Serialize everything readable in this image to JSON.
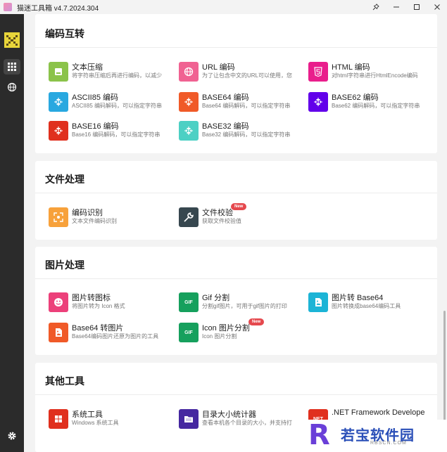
{
  "window": {
    "title": "猫迷工具箱 v4.7.2024.304",
    "icons": [
      "pin-icon",
      "minimize-icon",
      "maximize-icon",
      "close-icon"
    ]
  },
  "sidebar": {
    "items": [
      {
        "icon": "apps-grid-icon",
        "active": true
      },
      {
        "icon": "globe-icon",
        "active": false
      }
    ],
    "bottom_icon": "settings-gear-icon"
  },
  "sections": {
    "encoding": {
      "title": "编码互转",
      "tools": [
        {
          "name": "文本压缩",
          "desc": "将字符串压缩后再进行编码，以减少",
          "icon": "compress-icon",
          "color": "#8bc34a"
        },
        {
          "name": "URL 编码",
          "desc": "为了让包含中文的URL可以使用，您",
          "icon": "globe-icon",
          "color": "#f06292"
        },
        {
          "name": "HTML 编码",
          "desc": "对html字符串进行HtmlEncode编码",
          "icon": "html5-icon",
          "color": "#e91e8c"
        },
        {
          "name": "ASCII85 编码",
          "desc": "ASCII85 编码解码，可以指定字符串",
          "icon": "code-transform-icon",
          "color": "#29a8e0"
        },
        {
          "name": "BASE64 编码",
          "desc": "Base64 编码解码，可以指定字符串",
          "icon": "code-transform-icon",
          "color": "#f05a28"
        },
        {
          "name": "BASE62 编码",
          "desc": "Base62 编码解码，可以指定字符串",
          "icon": "code-transform-icon",
          "color": "#6200ea"
        },
        {
          "name": "BASE16 编码",
          "desc": "Base16 编码解码，可以指定字符串",
          "icon": "code-transform-icon",
          "color": "#e0301e"
        },
        {
          "name": "BASE32 编码",
          "desc": "Base32 编码解码，可以指定字符串",
          "icon": "code-transform-icon",
          "color": "#4dd0c4"
        }
      ]
    },
    "file": {
      "title": "文件处理",
      "tools": [
        {
          "name": "编码识别",
          "desc": "文本文件编码识别",
          "icon": "scan-frame-icon",
          "color": "#f7a13b"
        },
        {
          "name": "文件校验",
          "desc": "获取文件校验值",
          "icon": "wrench-icon",
          "color": "#37474f",
          "badge": "New"
        }
      ]
    },
    "image": {
      "title": "图片处理",
      "tools": [
        {
          "name": "图片转图标",
          "desc": "将图片转为 Icon 格式",
          "icon": "smiley-icon",
          "color": "#ec407a"
        },
        {
          "name": "Gif 分割",
          "desc": "分割gif图片，可用于gif图片的打印",
          "icon": "gif-icon",
          "color": "#16a05d",
          "label": "GIF"
        },
        {
          "name": "图片转 Base64",
          "desc": "图片转换成base64编码工具",
          "icon": "image-file-icon",
          "color": "#1cb4d6"
        },
        {
          "name": "Base64 转图片",
          "desc": "Base64编码图片还原为图片的工具",
          "icon": "image-file-icon",
          "color": "#f05a28"
        },
        {
          "name": "Icon 图片分割",
          "desc": "Icon 图片分割",
          "icon": "gif-icon",
          "color": "#16a05d",
          "label": "GIF",
          "badge": "New"
        }
      ]
    },
    "other": {
      "title": "其他工具",
      "tools": [
        {
          "name": "系统工具",
          "desc": "Windows 系统工具",
          "icon": "windows-logo-icon",
          "color": "#e0301e"
        },
        {
          "name": "目录大小统计器",
          "desc": "查看本机各个目录的大小，并支持打",
          "icon": "folder-icon",
          "color": "#4527a0"
        },
        {
          "name": ".NET Framework Develope",
          "desc": "",
          "icon": "dotnet-icon",
          "color": "#e0301e",
          "label": "NET"
        }
      ]
    }
  },
  "watermark": {
    "letter": "R",
    "text": "若宝软件园",
    "sub": "RBSCN.COM"
  }
}
